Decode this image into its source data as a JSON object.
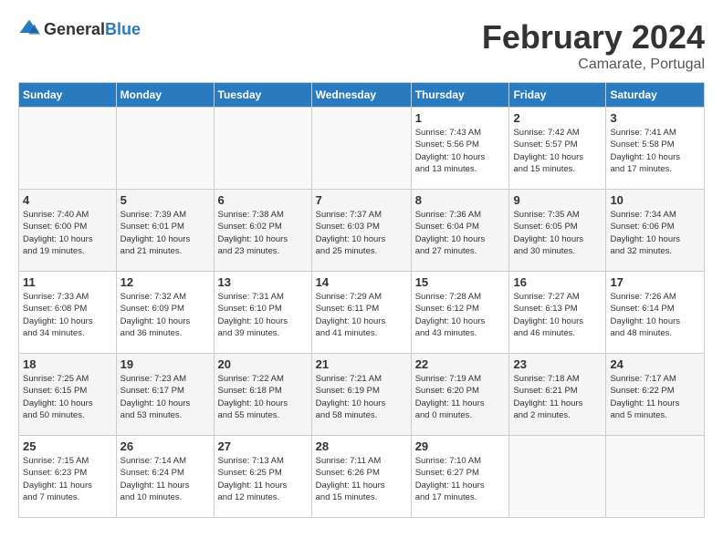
{
  "header": {
    "logo_general": "General",
    "logo_blue": "Blue",
    "month_year": "February 2024",
    "location": "Camarate, Portugal"
  },
  "days_of_week": [
    "Sunday",
    "Monday",
    "Tuesday",
    "Wednesday",
    "Thursday",
    "Friday",
    "Saturday"
  ],
  "weeks": [
    [
      {
        "day": "",
        "info": ""
      },
      {
        "day": "",
        "info": ""
      },
      {
        "day": "",
        "info": ""
      },
      {
        "day": "",
        "info": ""
      },
      {
        "day": "1",
        "info": "Sunrise: 7:43 AM\nSunset: 5:56 PM\nDaylight: 10 hours\nand 13 minutes."
      },
      {
        "day": "2",
        "info": "Sunrise: 7:42 AM\nSunset: 5:57 PM\nDaylight: 10 hours\nand 15 minutes."
      },
      {
        "day": "3",
        "info": "Sunrise: 7:41 AM\nSunset: 5:58 PM\nDaylight: 10 hours\nand 17 minutes."
      }
    ],
    [
      {
        "day": "4",
        "info": "Sunrise: 7:40 AM\nSunset: 6:00 PM\nDaylight: 10 hours\nand 19 minutes."
      },
      {
        "day": "5",
        "info": "Sunrise: 7:39 AM\nSunset: 6:01 PM\nDaylight: 10 hours\nand 21 minutes."
      },
      {
        "day": "6",
        "info": "Sunrise: 7:38 AM\nSunset: 6:02 PM\nDaylight: 10 hours\nand 23 minutes."
      },
      {
        "day": "7",
        "info": "Sunrise: 7:37 AM\nSunset: 6:03 PM\nDaylight: 10 hours\nand 25 minutes."
      },
      {
        "day": "8",
        "info": "Sunrise: 7:36 AM\nSunset: 6:04 PM\nDaylight: 10 hours\nand 27 minutes."
      },
      {
        "day": "9",
        "info": "Sunrise: 7:35 AM\nSunset: 6:05 PM\nDaylight: 10 hours\nand 30 minutes."
      },
      {
        "day": "10",
        "info": "Sunrise: 7:34 AM\nSunset: 6:06 PM\nDaylight: 10 hours\nand 32 minutes."
      }
    ],
    [
      {
        "day": "11",
        "info": "Sunrise: 7:33 AM\nSunset: 6:08 PM\nDaylight: 10 hours\nand 34 minutes."
      },
      {
        "day": "12",
        "info": "Sunrise: 7:32 AM\nSunset: 6:09 PM\nDaylight: 10 hours\nand 36 minutes."
      },
      {
        "day": "13",
        "info": "Sunrise: 7:31 AM\nSunset: 6:10 PM\nDaylight: 10 hours\nand 39 minutes."
      },
      {
        "day": "14",
        "info": "Sunrise: 7:29 AM\nSunset: 6:11 PM\nDaylight: 10 hours\nand 41 minutes."
      },
      {
        "day": "15",
        "info": "Sunrise: 7:28 AM\nSunset: 6:12 PM\nDaylight: 10 hours\nand 43 minutes."
      },
      {
        "day": "16",
        "info": "Sunrise: 7:27 AM\nSunset: 6:13 PM\nDaylight: 10 hours\nand 46 minutes."
      },
      {
        "day": "17",
        "info": "Sunrise: 7:26 AM\nSunset: 6:14 PM\nDaylight: 10 hours\nand 48 minutes."
      }
    ],
    [
      {
        "day": "18",
        "info": "Sunrise: 7:25 AM\nSunset: 6:15 PM\nDaylight: 10 hours\nand 50 minutes."
      },
      {
        "day": "19",
        "info": "Sunrise: 7:23 AM\nSunset: 6:17 PM\nDaylight: 10 hours\nand 53 minutes."
      },
      {
        "day": "20",
        "info": "Sunrise: 7:22 AM\nSunset: 6:18 PM\nDaylight: 10 hours\nand 55 minutes."
      },
      {
        "day": "21",
        "info": "Sunrise: 7:21 AM\nSunset: 6:19 PM\nDaylight: 10 hours\nand 58 minutes."
      },
      {
        "day": "22",
        "info": "Sunrise: 7:19 AM\nSunset: 6:20 PM\nDaylight: 11 hours\nand 0 minutes."
      },
      {
        "day": "23",
        "info": "Sunrise: 7:18 AM\nSunset: 6:21 PM\nDaylight: 11 hours\nand 2 minutes."
      },
      {
        "day": "24",
        "info": "Sunrise: 7:17 AM\nSunset: 6:22 PM\nDaylight: 11 hours\nand 5 minutes."
      }
    ],
    [
      {
        "day": "25",
        "info": "Sunrise: 7:15 AM\nSunset: 6:23 PM\nDaylight: 11 hours\nand 7 minutes."
      },
      {
        "day": "26",
        "info": "Sunrise: 7:14 AM\nSunset: 6:24 PM\nDaylight: 11 hours\nand 10 minutes."
      },
      {
        "day": "27",
        "info": "Sunrise: 7:13 AM\nSunset: 6:25 PM\nDaylight: 11 hours\nand 12 minutes."
      },
      {
        "day": "28",
        "info": "Sunrise: 7:11 AM\nSunset: 6:26 PM\nDaylight: 11 hours\nand 15 minutes."
      },
      {
        "day": "29",
        "info": "Sunrise: 7:10 AM\nSunset: 6:27 PM\nDaylight: 11 hours\nand 17 minutes."
      },
      {
        "day": "",
        "info": ""
      },
      {
        "day": "",
        "info": ""
      }
    ]
  ]
}
